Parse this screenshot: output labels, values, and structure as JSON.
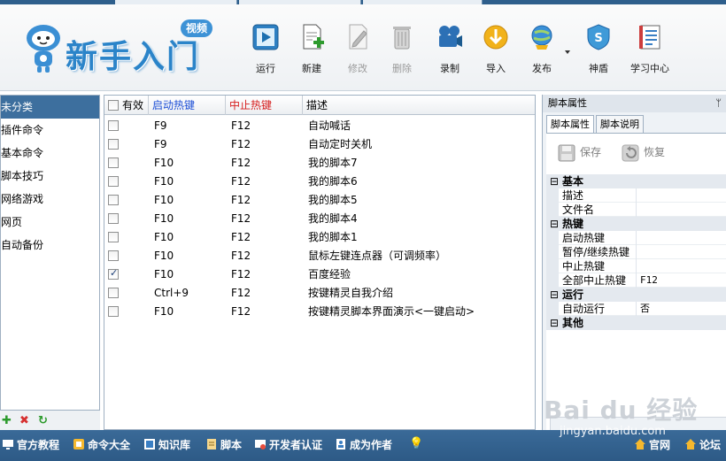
{
  "logo": {
    "text": "新手入门",
    "badge": "视频"
  },
  "toolbar": {
    "buttons": [
      {
        "label": "运行",
        "icon": "run-icon",
        "enabled": true
      },
      {
        "label": "新建",
        "icon": "new-icon",
        "enabled": true
      },
      {
        "label": "修改",
        "icon": "edit-icon",
        "enabled": false
      },
      {
        "label": "删除",
        "icon": "delete-icon",
        "enabled": false
      },
      {
        "label": "录制",
        "icon": "record-icon",
        "enabled": true
      },
      {
        "label": "导入",
        "icon": "import-icon",
        "enabled": true
      },
      {
        "label": "发布",
        "icon": "publish-icon",
        "enabled": true
      },
      {
        "label": "神盾",
        "icon": "shield-icon",
        "enabled": true
      },
      {
        "label": "学习中心",
        "icon": "learning-center-icon",
        "enabled": true
      }
    ]
  },
  "categories": {
    "items": [
      "未分类",
      "插件命令",
      "基本命令",
      "脚本技巧",
      "网络游戏",
      "网页",
      "自动备份"
    ],
    "selected": "未分类",
    "tools": [
      "add-icon",
      "remove-icon",
      "refresh-icon"
    ]
  },
  "script_list": {
    "headers": {
      "enabled": "有效",
      "start_hotkey": "启动热键",
      "stop_hotkey": "中止热键",
      "description": "描述"
    },
    "rows": [
      {
        "checked": false,
        "start": "F9",
        "stop": "F12",
        "desc": "自动喊话"
      },
      {
        "checked": false,
        "start": "F9",
        "stop": "F12",
        "desc": "自动定时关机"
      },
      {
        "checked": false,
        "start": "F10",
        "stop": "F12",
        "desc": "我的脚本7"
      },
      {
        "checked": false,
        "start": "F10",
        "stop": "F12",
        "desc": "我的脚本6"
      },
      {
        "checked": false,
        "start": "F10",
        "stop": "F12",
        "desc": "我的脚本5"
      },
      {
        "checked": false,
        "start": "F10",
        "stop": "F12",
        "desc": "我的脚本4"
      },
      {
        "checked": false,
        "start": "F10",
        "stop": "F12",
        "desc": "我的脚本1"
      },
      {
        "checked": false,
        "start": "F10",
        "stop": "F12",
        "desc": "鼠标左键连点器（可调频率）"
      },
      {
        "checked": true,
        "start": "F10",
        "stop": "F12",
        "desc": "百度经验"
      },
      {
        "checked": false,
        "start": "Ctrl+9",
        "stop": "F12",
        "desc": "按键精灵自我介绍"
      },
      {
        "checked": false,
        "start": "F10",
        "stop": "F12",
        "desc": "按键精灵脚本界面演示<一键启动>"
      }
    ]
  },
  "properties": {
    "title": "脚本属性",
    "tabs": [
      "脚本属性",
      "脚本说明"
    ],
    "active_tab": "脚本属性",
    "save_label": "保存",
    "restore_label": "恢复",
    "groups": [
      {
        "name": "基本",
        "items": [
          {
            "key": "描述",
            "value": ""
          },
          {
            "key": "文件名",
            "value": ""
          }
        ]
      },
      {
        "name": "热键",
        "items": [
          {
            "key": "启动热键",
            "value": ""
          },
          {
            "key": "暂停/继续热键",
            "value": ""
          },
          {
            "key": "中止热键",
            "value": ""
          },
          {
            "key": "全部中止热键",
            "value": "F12"
          }
        ]
      },
      {
        "name": "运行",
        "items": [
          {
            "key": "自动运行",
            "value": "否"
          }
        ]
      },
      {
        "name": "其他",
        "items": []
      }
    ]
  },
  "bottom_links": {
    "official_tutorial": "官方教程",
    "commands": "命令大全",
    "knowledge": "知识库",
    "scripts": "脚本",
    "dev_cert": "开发者认证",
    "become_author": "成为作者",
    "official_site": "官网",
    "forum": "论坛"
  },
  "watermark": {
    "logo": "Bai du 经验",
    "url": "jingyan.baidu.com"
  },
  "colors": {
    "accent": "#3d6f9e",
    "start_hotkey_header": "#1d4fd6",
    "stop_hotkey_header": "#d61d1d",
    "bottom_bar": "#2f5f8c"
  }
}
